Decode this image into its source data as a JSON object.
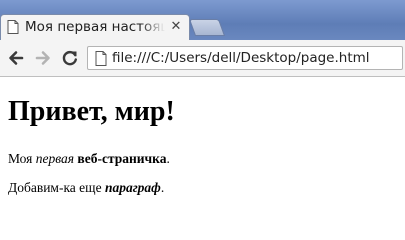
{
  "browser": {
    "tab": {
      "title": "Моя первая настоящ",
      "close_glyph": "✕",
      "icon": "page-icon"
    },
    "new_tab": {
      "icon": "new-tab-icon"
    },
    "toolbar": {
      "back_icon": "arrow-left-icon",
      "forward_icon": "arrow-right-icon",
      "reload_icon": "reload-icon",
      "address": "file:///C:/Users/dell/Desktop/page.html"
    },
    "colors": {
      "tabstrip": "#5e7db6",
      "toolbar": "#f4f4f4"
    }
  },
  "page": {
    "heading": "Привет, мир!",
    "paragraph1": {
      "part1": "Моя ",
      "italic": "первая",
      "part2": " ",
      "bold": "веб-страничка",
      "part3": "."
    },
    "paragraph2": {
      "part1": "Добавим-ка еще ",
      "bold_italic": "параграф",
      "part2": "."
    }
  }
}
